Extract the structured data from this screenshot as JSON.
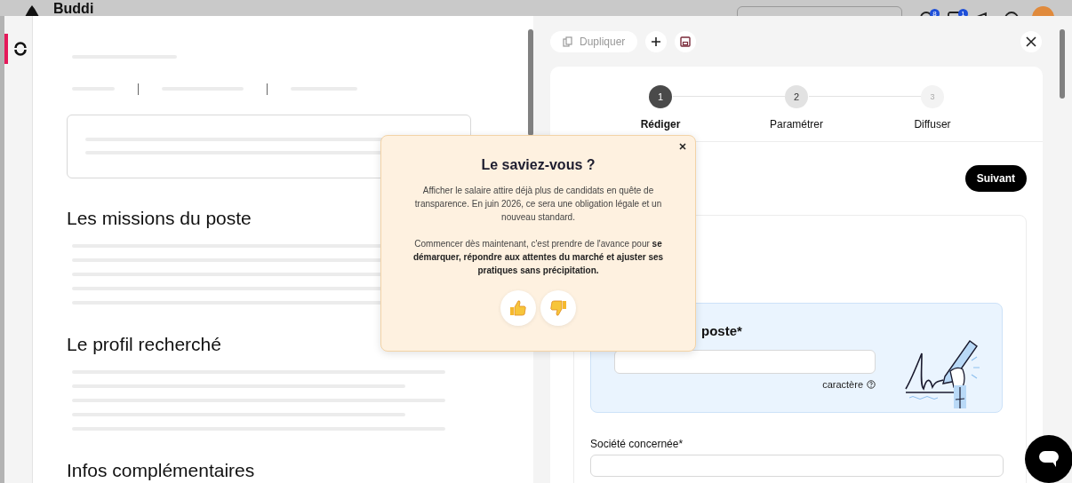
{
  "app_header": {
    "logo_text": "Buddi",
    "badges": [
      {
        "count": "8"
      },
      {
        "count": "1"
      }
    ]
  },
  "sidebar": {
    "items": [
      {
        "selected": true
      }
    ]
  },
  "preview": {
    "sections": [
      {
        "title": "Les missions du poste"
      },
      {
        "title": "Le profil recherché"
      },
      {
        "title": "Infos complémentaires"
      }
    ]
  },
  "editor": {
    "duplicate_label": "Dupliquer",
    "steps": [
      {
        "number": "1",
        "label": "Rédiger",
        "selected": true,
        "disabled": false
      },
      {
        "number": "2",
        "label": "Paramétrer",
        "selected": false,
        "disabled": false
      },
      {
        "number": "3",
        "label": "Diffuser",
        "selected": false,
        "disabled": true
      }
    ],
    "next_button": "Suivant",
    "title_field": {
      "label": "poste*",
      "hint": "caractère"
    },
    "company_field": {
      "label": "Société concernée*"
    }
  },
  "tip_popup": {
    "title": "Le saviez-vous ?",
    "paragraphs": [
      "Afficher le salaire attire déjà plus de candidats en quête de transparence. En juin 2026, ce sera une obligation légale et un nouveau standard.",
      "Commencer dès maintenant, c'est prendre de l'avance pour **se démarquer, répondre aux attentes du marché et ajuster ses pratiques sans précipitation.**"
    ]
  }
}
